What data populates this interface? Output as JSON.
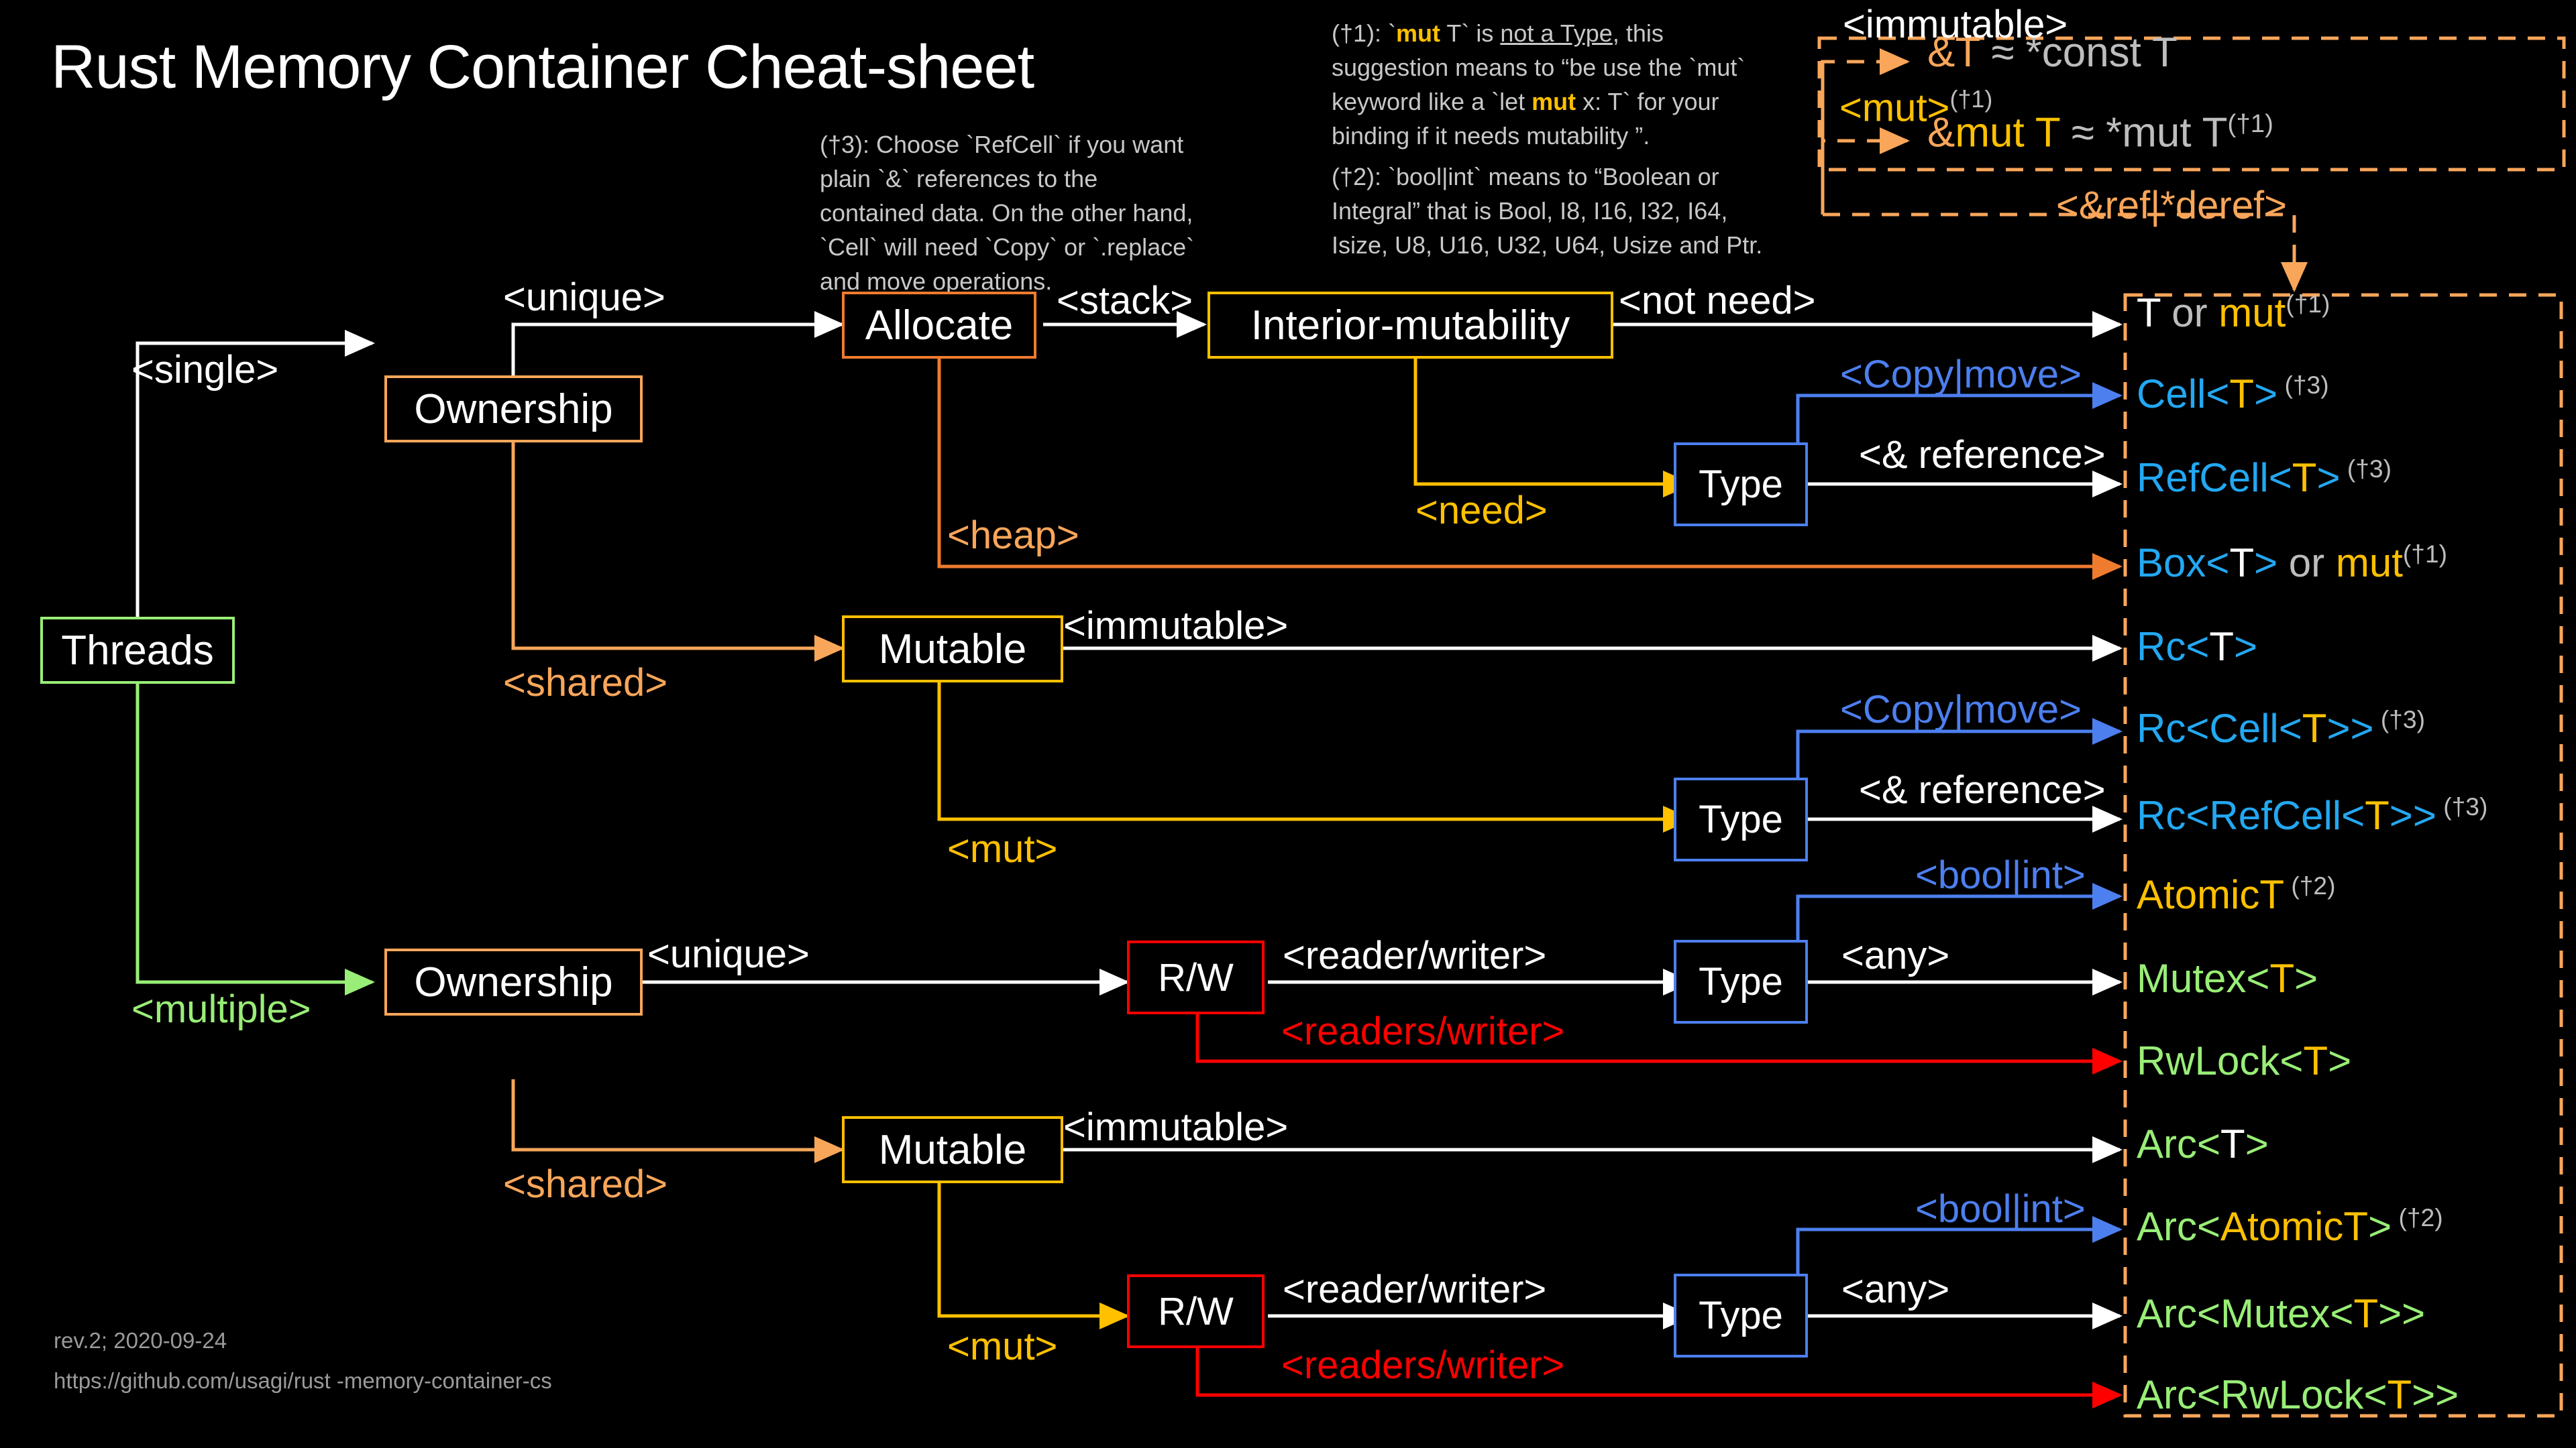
{
  "title": "Rust Memory Container Cheat-sheet",
  "footer": {
    "rev": "rev.2; 2020-09-24",
    "url": "https://github.com/usagi/rust -memory-container-cs"
  },
  "notes": {
    "n3": "(†3): Choose `RefCell` if you want plain `&` references to the contained data. On the other hand, `Cell` will need `Copy` or `.replace` and move operations.",
    "n1_a": "(†1): `",
    "n1_mut": "mut",
    "n1_b": " T` is ",
    "n1_u": "not a Type",
    "n1_c": ", this suggestion means to “be use the `mut` keyword like a `let ",
    "n1_mut2": "mut",
    "n1_d": " x: T` for your binding if it needs mutability ”.",
    "n2": "(†2): `bool|int` means to “Boolean or Integral” that is Bool, I8, I16, I32, I64, Isize, U8, U16, U32, U64,  Usize and Ptr."
  },
  "ref_panel": {
    "immutable_label": "<immutable>",
    "mut_label": "<mut>",
    "mut_sup": "(†1)",
    "deref_label": "<&ref|*deref>",
    "row1": {
      "amp": "&T",
      "approx": " ≈ ",
      "rhs": "*const T"
    },
    "row2": {
      "amp": "&",
      "mut": "mut",
      "t": " T",
      "approx": " ≈ ",
      "rhs": "*mut T",
      "sup": "(†1)"
    }
  },
  "nodes": {
    "threads": "Threads",
    "ownership_single": "Ownership",
    "ownership_multi": "Ownership",
    "allocate": "Allocate",
    "interior_mutability": "Interior-mutability",
    "mutable_single": "Mutable",
    "mutable_multi": "Mutable",
    "type_a": "Type",
    "type_b": "Type",
    "type_c": "Type",
    "type_d": "Type",
    "rw_single": "R/W",
    "rw_multi": "R/W"
  },
  "edges": {
    "single": "<single>",
    "multiple": "<multiple>",
    "unique_top": "<unique>",
    "unique_bottom": "<unique>",
    "shared_top": "<shared>",
    "shared_bottom": "<shared>",
    "stack": "<stack>",
    "heap": "<heap>",
    "not_need": "<not need>",
    "need": "<need>",
    "copy_move_1": "<Copy|move>",
    "copy_move_2": "<Copy|move>",
    "ref_1": "<& reference>",
    "ref_2": "<& reference>",
    "immutable_1": "<immutable>",
    "immutable_2": "<immutable>",
    "mut_1": "<mut>",
    "mut_2": "<mut>",
    "reader_writer_1": "<reader/writer>",
    "reader_writer_2": "<reader/writer>",
    "readers_writer_1": "<readers/writer>",
    "readers_writer_2": "<readers/writer>",
    "bool_int_1": "<bool|int>",
    "bool_int_2": "<bool|int>",
    "any_1": "<any>",
    "any_2": "<any>"
  },
  "types": [
    {
      "id": "t-or-mut",
      "parts": [
        {
          "t": "T",
          "c": "w"
        },
        {
          "t": " or ",
          "c": "gr"
        },
        {
          "t": "mut",
          "c": "am"
        }
      ],
      "sup": "(†1)",
      "sup_c": "gr"
    },
    {
      "id": "cell",
      "parts": [
        {
          "t": "Cell<",
          "c": "cy"
        },
        {
          "t": "T",
          "c": "am"
        },
        {
          "t": ">",
          "c": "cy"
        }
      ],
      "sup": " (†3)",
      "sup_c": "gr"
    },
    {
      "id": "refcell",
      "parts": [
        {
          "t": "RefCell<",
          "c": "cy"
        },
        {
          "t": "T",
          "c": "am"
        },
        {
          "t": ">",
          "c": "cy"
        }
      ],
      "sup": " (†3)",
      "sup_c": "gr"
    },
    {
      "id": "box",
      "parts": [
        {
          "t": "Box<",
          "c": "cy"
        },
        {
          "t": "T",
          "c": "w"
        },
        {
          "t": ">",
          "c": "cy"
        },
        {
          "t": " or ",
          "c": "gr"
        },
        {
          "t": "mut",
          "c": "am"
        }
      ],
      "sup": "(†1)",
      "sup_c": "gr"
    },
    {
      "id": "rc",
      "parts": [
        {
          "t": "Rc<",
          "c": "cy"
        },
        {
          "t": "T",
          "c": "w"
        },
        {
          "t": ">",
          "c": "cy"
        }
      ],
      "sup": "",
      "sup_c": "gr"
    },
    {
      "id": "rc-cell",
      "parts": [
        {
          "t": "Rc<Cell<",
          "c": "cy"
        },
        {
          "t": "T",
          "c": "am"
        },
        {
          "t": ">>",
          "c": "cy"
        }
      ],
      "sup": " (†3)",
      "sup_c": "gr"
    },
    {
      "id": "rc-refcell",
      "parts": [
        {
          "t": "Rc<RefCell<",
          "c": "cy"
        },
        {
          "t": "T",
          "c": "am"
        },
        {
          "t": ">>",
          "c": "cy"
        }
      ],
      "sup": " (†3)",
      "sup_c": "gr"
    },
    {
      "id": "atomict",
      "parts": [
        {
          "t": "AtomicT",
          "c": "am"
        }
      ],
      "sup": " (†2)",
      "sup_c": "gr"
    },
    {
      "id": "mutex",
      "parts": [
        {
          "t": "Mutex<",
          "c": "gn"
        },
        {
          "t": "T",
          "c": "am"
        },
        {
          "t": ">",
          "c": "gn"
        }
      ],
      "sup": "",
      "sup_c": "gr"
    },
    {
      "id": "rwlock",
      "parts": [
        {
          "t": "RwLock<",
          "c": "gn"
        },
        {
          "t": "T",
          "c": "am"
        },
        {
          "t": ">",
          "c": "gn"
        }
      ],
      "sup": "",
      "sup_c": "gr"
    },
    {
      "id": "arc",
      "parts": [
        {
          "t": "Arc<",
          "c": "gn"
        },
        {
          "t": "T",
          "c": "w"
        },
        {
          "t": ">",
          "c": "gn"
        }
      ],
      "sup": "",
      "sup_c": "gr"
    },
    {
      "id": "arc-atomict",
      "parts": [
        {
          "t": "Arc<",
          "c": "gn"
        },
        {
          "t": "AtomicT",
          "c": "am"
        },
        {
          "t": ">",
          "c": "gn"
        }
      ],
      "sup": " (†2)",
      "sup_c": "gr"
    },
    {
      "id": "arc-mutex",
      "parts": [
        {
          "t": "Arc<Mutex<",
          "c": "gn"
        },
        {
          "t": "T",
          "c": "am"
        },
        {
          "t": ">>",
          "c": "gn"
        }
      ],
      "sup": "",
      "sup_c": "gr"
    },
    {
      "id": "arc-rwlock",
      "parts": [
        {
          "t": "Arc<RwLock<",
          "c": "gn"
        },
        {
          "t": "T",
          "c": "am"
        },
        {
          "t": ">>",
          "c": "gn"
        }
      ],
      "sup": "",
      "sup_c": "gr"
    }
  ],
  "colors": {
    "background": "#000000",
    "white": "#ffffff",
    "grey": "#bdbdbd",
    "orange": "#f9a65a",
    "deep_orange": "#ef7b2f",
    "amber": "#ffc000",
    "cyan": "#23a8f2",
    "green": "#99ee77",
    "blue": "#4d7fef",
    "red": "#ff0000"
  }
}
